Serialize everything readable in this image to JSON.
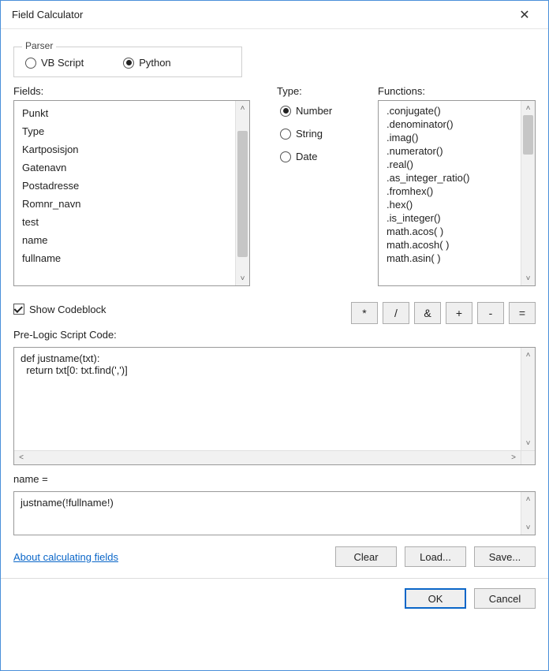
{
  "window": {
    "title": "Field Calculator"
  },
  "parser": {
    "legend": "Parser",
    "options": [
      {
        "label": "VB Script",
        "selected": false
      },
      {
        "label": "Python",
        "selected": true
      }
    ]
  },
  "fields": {
    "label": "Fields:",
    "items": [
      "Punkt",
      "Type",
      "Kartposisjon",
      "Gatenavn",
      "Postadresse",
      "Romnr_navn",
      "test",
      "name",
      "fullname"
    ]
  },
  "type": {
    "label": "Type:",
    "options": [
      {
        "label": "Number",
        "selected": true
      },
      {
        "label": "String",
        "selected": false
      },
      {
        "label": "Date",
        "selected": false
      }
    ]
  },
  "functions": {
    "label": "Functions:",
    "items": [
      ".conjugate()",
      ".denominator()",
      ".imag()",
      ".numerator()",
      ".real()",
      ".as_integer_ratio()",
      ".fromhex()",
      ".hex()",
      ".is_integer()",
      "math.acos( )",
      "math.acosh( )",
      "math.asin( )"
    ]
  },
  "operators": [
    "*",
    "/",
    "&",
    "+",
    "-",
    "="
  ],
  "codeblock": {
    "checkbox_label": "Show Codeblock",
    "checked": true,
    "label": "Pre-Logic Script Code:",
    "code": "def justname(txt):\n  return txt[0: txt.find(',')]"
  },
  "expression": {
    "label": "name =",
    "value": "justname(!fullname!)"
  },
  "link": {
    "text": "About calculating fields"
  },
  "buttons": {
    "clear": "Clear",
    "load": "Load...",
    "save": "Save...",
    "ok": "OK",
    "cancel": "Cancel"
  }
}
